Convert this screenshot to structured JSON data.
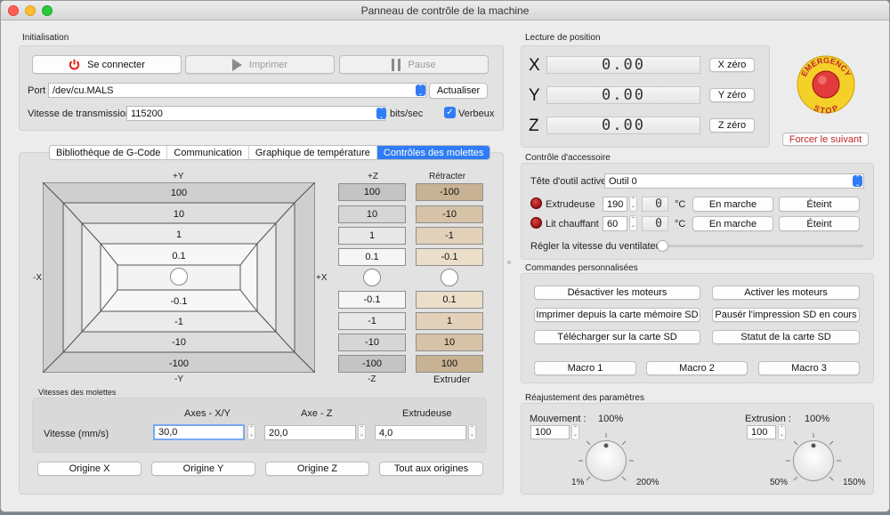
{
  "window": {
    "title": "Panneau de contrôle de la machine"
  },
  "colors": {
    "accent": "#2f7cf6",
    "retract_base": "#e9d8c0",
    "emergency": "#f4d028",
    "forcer": "#c0262b"
  },
  "init": {
    "section": "Initialisation",
    "connect": "Se connecter",
    "print": "Imprimer",
    "pause": "Pause",
    "port_label": "Port",
    "port_value": "/dev/cu.MALS",
    "refresh": "Actualiser",
    "baud_label": "Vitesse de transmission",
    "baud_value": "115200",
    "baud_unit": "bits/sec",
    "verbose": "Verbeux"
  },
  "tabs": [
    {
      "label": "Bibliothèque de G-Code"
    },
    {
      "label": "Communication"
    },
    {
      "label": "Graphique de température"
    },
    {
      "label": "Contrôles des molettes"
    }
  ],
  "jog": {
    "plus_y": "+Y",
    "minus_y": "-Y",
    "minus_x": "-X",
    "plus_x": "+X",
    "y_steps": [
      "100",
      "10",
      "1",
      "0.1",
      "-0.1",
      "-1",
      "-10",
      "-100"
    ],
    "plus_z": "+Z",
    "minus_z": "-Z",
    "z_steps": [
      "100",
      "10",
      "1",
      "0.1",
      "-0.1",
      "-1",
      "-10",
      "-100"
    ],
    "retract": "Rétracter",
    "extrude": "Extruder",
    "e_steps": [
      "-100",
      "-10",
      "-1",
      "-0.1",
      "0.1",
      "1",
      "10",
      "100"
    ]
  },
  "speeds": {
    "section": "Vitesses des molettes",
    "col_xy": "Axes - X/Y",
    "col_z": "Axe - Z",
    "col_e": "Extrudeuse",
    "row_label": "Vitesse (mm/s)",
    "xy": "30,0",
    "z": "20,0",
    "e": "4,0"
  },
  "homes": {
    "x": "Origine X",
    "y": "Origine Y",
    "z": "Origine Z",
    "all": "Tout aux origines"
  },
  "position": {
    "section": "Lecture de position",
    "x_label": "X",
    "y_label": "Y",
    "z_label": "Z",
    "x": "0.00",
    "y": "0.00",
    "z": "0.00",
    "x_zero": "X zéro",
    "y_zero": "Y zéro",
    "z_zero": "Z zéro",
    "estop_top": "EMERGENCY",
    "estop_bottom": "STOP",
    "force": "Forcer le suivant"
  },
  "accessory": {
    "section": "Contrôle d'accessoire",
    "tool_label": "Tête d'outil active",
    "tool_value": "Outil 0",
    "extruder_label": "Extrudeuse",
    "extruder_set": "190",
    "extruder_temp": "0",
    "unit": "°C",
    "bed_label": "Lit chauffant",
    "bed_set": "60",
    "bed_temp": "0",
    "on": "En marche",
    "off": "Éteint",
    "fan_label": "Régler la vitesse du ventilateur",
    "fan_level": 0
  },
  "custom": {
    "section": "Commandes personnalisées",
    "motors_off": "Désactiver les moteurs",
    "motors_on": "Activer les moteurs",
    "print_sd": "Imprimer depuis la carte mémoire SD",
    "pause_sd": "Pausér l'impression SD en cours",
    "upload_sd": "Télécharger sur la carte SD",
    "sd_status": "Statut de la carte SD",
    "macro1": "Macro 1",
    "macro2": "Macro 2",
    "macro3": "Macro 3"
  },
  "adjust": {
    "section": "Réajustement des paramètres",
    "move_label": "Mouvement :",
    "move_pct": "100%",
    "move_value": "100",
    "move_min": "1%",
    "move_max": "200%",
    "ext_label": "Extrusion :",
    "ext_pct": "100%",
    "ext_value": "100",
    "ext_min": "50%",
    "ext_max": "150%"
  }
}
